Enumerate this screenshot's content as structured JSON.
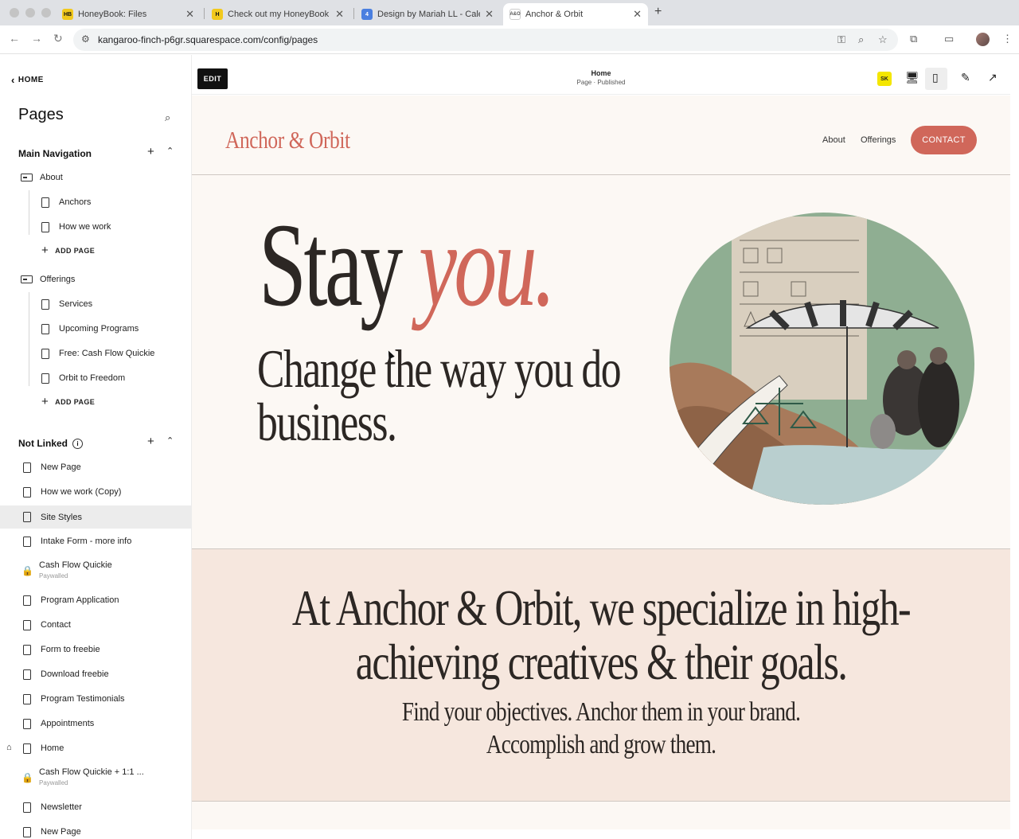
{
  "browser": {
    "tabs": [
      {
        "title": "HoneyBook: Files",
        "favicon": "HB",
        "favicon_color": "#f2c91d"
      },
      {
        "title": "Check out my HoneyBook ter",
        "favicon": "H",
        "favicon_color": "#f2c91d"
      },
      {
        "title": "Design by Mariah LL - Calend",
        "favicon": "4",
        "favicon_color": "#4a7fe0"
      },
      {
        "title": "Anchor & Orbit",
        "favicon": "A&O",
        "favicon_color": "#ffffff"
      }
    ],
    "url": "kangaroo-finch-p6gr.squarespace.com/config/pages"
  },
  "sidebar": {
    "back_label": "HOME",
    "title": "Pages",
    "main_nav_label": "Main Navigation",
    "not_linked_label": "Not Linked",
    "add_page_label": "ADD PAGE",
    "main_nav": {
      "about": {
        "label": "About",
        "children": [
          "Anchors",
          "How we work"
        ]
      },
      "offerings": {
        "label": "Offerings",
        "children": [
          "Services",
          "Upcoming Programs",
          "Free: Cash Flow Quickie",
          "Orbit to Freedom"
        ]
      }
    },
    "not_linked": [
      {
        "label": "New Page",
        "icon": "page"
      },
      {
        "label": "How we work (Copy)",
        "icon": "page"
      },
      {
        "label": "Site Styles",
        "icon": "page",
        "selected": true
      },
      {
        "label": "Intake Form - more info",
        "icon": "page"
      },
      {
        "label": "Cash Flow Quickie",
        "icon": "paywall",
        "sub": "Paywalled"
      },
      {
        "label": "Program Application",
        "icon": "page"
      },
      {
        "label": "Contact",
        "icon": "page"
      },
      {
        "label": "Form to freebie",
        "icon": "page"
      },
      {
        "label": "Download freebie",
        "icon": "page"
      },
      {
        "label": "Program Testimonials",
        "icon": "page"
      },
      {
        "label": "Appointments",
        "icon": "page"
      },
      {
        "label": "Home",
        "icon": "page",
        "homepage": true
      },
      {
        "label": "Cash Flow Quickie + 1:1 ...",
        "icon": "paywall",
        "sub": "Paywalled"
      },
      {
        "label": "Newsletter",
        "icon": "page"
      },
      {
        "label": "New Page",
        "icon": "page"
      }
    ]
  },
  "editor": {
    "edit_label": "EDIT",
    "page_name": "Home",
    "page_status": "Page · Published",
    "sk_badge": "SK"
  },
  "site": {
    "logo": "Anchor & Orbit",
    "nav": [
      "About",
      "Offerings"
    ],
    "contact_label": "CONTACT",
    "hero_stay": "Stay",
    "hero_you": "you.",
    "hero_sub": "Change the way you do business.",
    "band_heading": "At Anchor & Orbit, we specialize in high-achieving creatives & their goals.",
    "band_sub_1": "Find your objectives. Anchor them in your brand.",
    "band_sub_2": "Accomplish and grow them."
  },
  "colors": {
    "accent": "#d0675a",
    "text_dark": "#2c2724",
    "page_bg": "#fcf8f4",
    "band_bg": "#f6e7de"
  }
}
